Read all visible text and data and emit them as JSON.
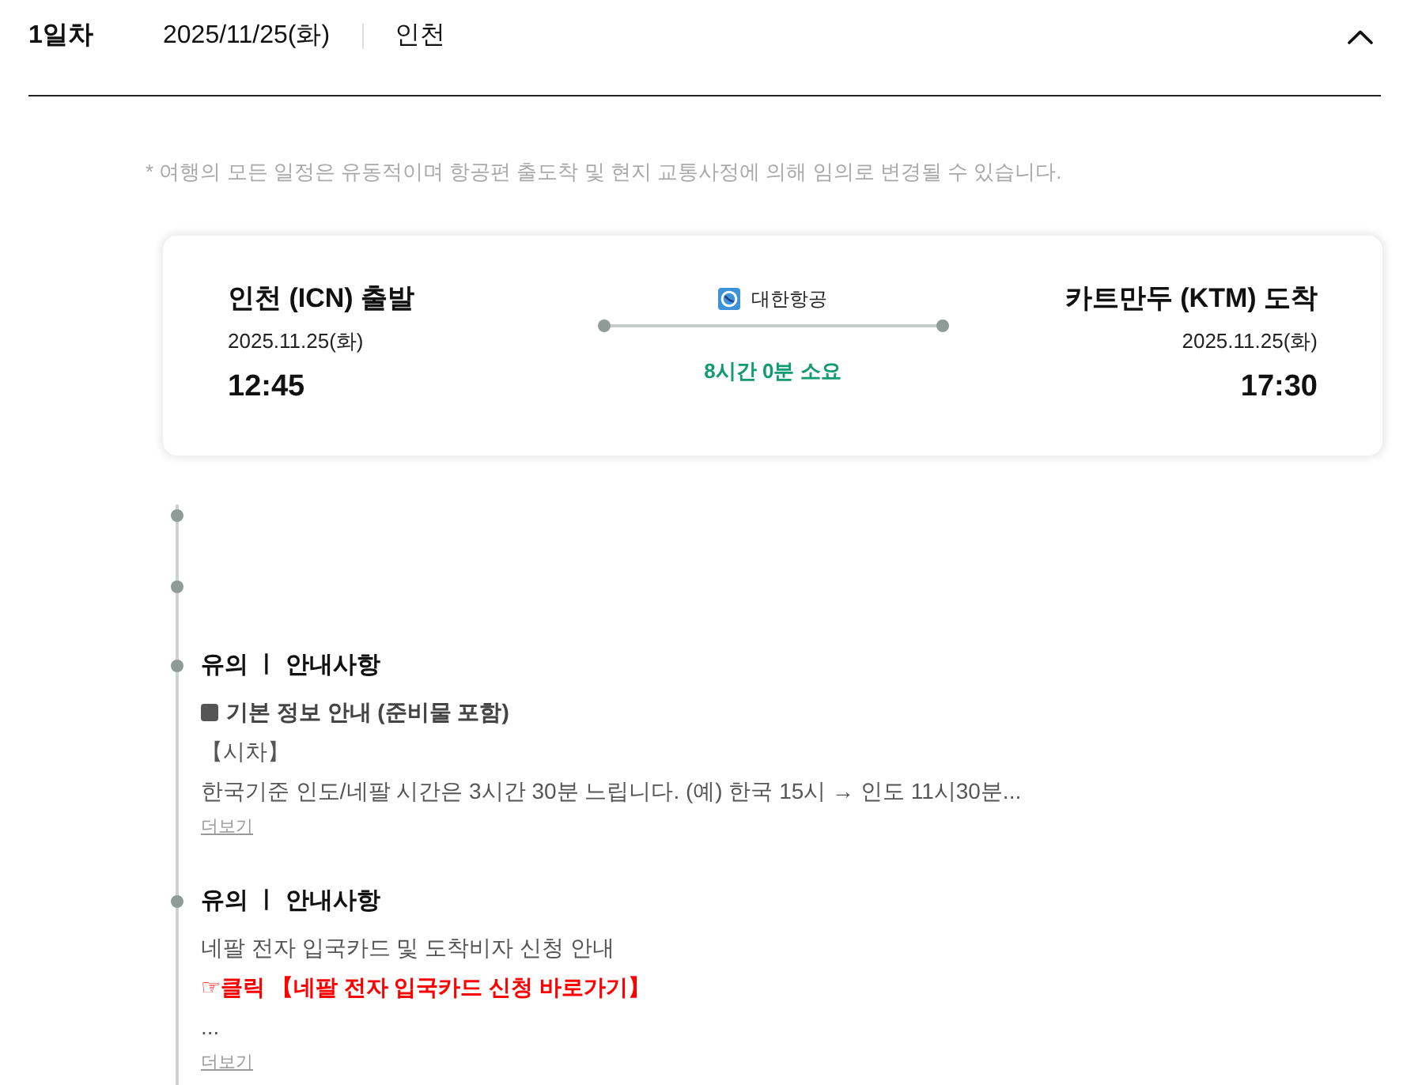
{
  "day_header": {
    "day": "1일차",
    "date": "2025/11/25(화)",
    "city": "인천",
    "expanded": true
  },
  "notice": "* 여행의 모든 일정은 유동적이며 항공편 출도착 및 현지 교통사정에 의해 임의로 변경될 수 있습니다.",
  "flight": {
    "departure": {
      "place": "인천 (ICN) 출발",
      "date": "2025.11.25(화)",
      "time": "12:45"
    },
    "airline": "대한항공",
    "duration": "8시간 0분 소요",
    "arrival": {
      "place": "카트만두 (KTM) 도착",
      "date": "2025.11.25(화)",
      "time": "17:30"
    }
  },
  "timeline": [
    {
      "kind": "marker"
    },
    {
      "kind": "marker"
    },
    {
      "kind": "note",
      "title": "유의 ㅣ 안내사항",
      "lines": [
        {
          "kind": "heading",
          "text": "기본 정보 안내 (준비물 포함)"
        },
        {
          "kind": "text",
          "text": "【시차】"
        },
        {
          "kind": "text",
          "text": "한국기준 인도/네팔 시간은 3시간 30분 느립니다. (예) 한국 15시 → 인도 11시30분..."
        }
      ],
      "more": "더보기"
    },
    {
      "kind": "note",
      "title": "유의 ㅣ 안내사항",
      "lines": [
        {
          "kind": "text",
          "text": "네팔 전자 입국카드 및 도착비자 신청 안내"
        },
        {
          "kind": "link",
          "text": "☞클릭 【네팔 전자 입국카드 신청 바로가기】"
        },
        {
          "kind": "text",
          "text": "..."
        }
      ],
      "more": "더보기"
    }
  ]
}
